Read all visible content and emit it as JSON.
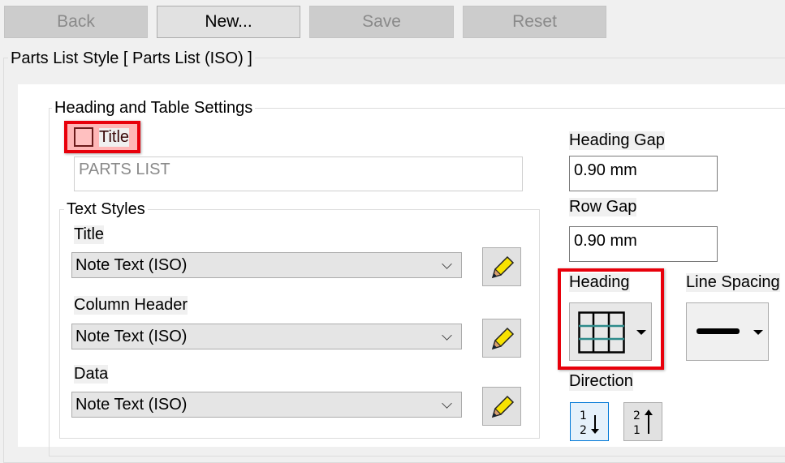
{
  "toolbar": {
    "back": "Back",
    "new": "New...",
    "save": "Save",
    "reset": "Reset"
  },
  "style_group": {
    "title": "Parts List Style [ Parts List (ISO) ]"
  },
  "heading_settings": {
    "title": "Heading and Table Settings",
    "title_checkbox": {
      "label": "Title",
      "checked": false
    },
    "title_text": "PARTS LIST",
    "text_styles": {
      "title": "Text Styles",
      "rows": [
        {
          "label": "Title",
          "value": "Note Text (ISO)"
        },
        {
          "label": "Column Header",
          "value": "Note Text (ISO)"
        },
        {
          "label": "Data",
          "value": "Note Text (ISO)"
        }
      ]
    },
    "heading_gap": {
      "label": "Heading Gap",
      "value": "0.90 mm"
    },
    "row_gap": {
      "label": "Row Gap",
      "value": "0.90 mm"
    },
    "heading": {
      "label": "Heading"
    },
    "line_spacing": {
      "label": "Line Spacing"
    },
    "direction": {
      "label": "Direction",
      "selected": "top-down"
    }
  },
  "colors": {
    "highlight": "#e8000b",
    "grid_accent": "#2e8b8b"
  }
}
